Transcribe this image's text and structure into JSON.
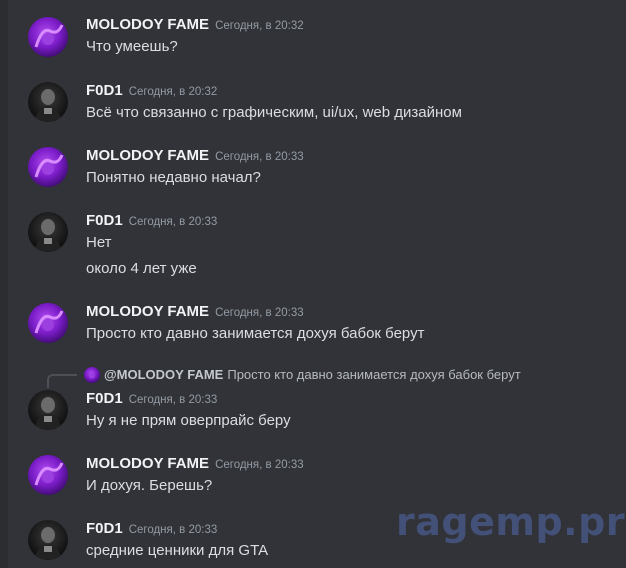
{
  "messages": [
    {
      "author": "MOLODOY FAME",
      "time": "Сегодня, в 20:32",
      "lines": [
        "Что умеешь?"
      ]
    },
    {
      "author": "F0D1",
      "time": "Сегодня, в 20:32",
      "lines": [
        "Всё что связанно с графическим, ui/ux, web дизайном"
      ]
    },
    {
      "author": "MOLODOY FAME",
      "time": "Сегодня, в 20:33",
      "lines": [
        "Понятно недавно начал?"
      ]
    },
    {
      "author": "F0D1",
      "time": "Сегодня, в 20:33",
      "lines": [
        "Нет",
        "около 4 лет уже"
      ]
    },
    {
      "author": "MOLODOY FAME",
      "time": "Сегодня, в 20:33",
      "lines": [
        "Просто кто давно занимается дохуя бабок берут"
      ]
    },
    {
      "author": "F0D1",
      "time": "Сегодня, в 20:33",
      "lines": [
        "Ну я не прям оверпрайс беру"
      ],
      "reply": {
        "author": "@MOLODOY FAME",
        "text": "Просто кто давно занимается дохуя бабок берут"
      }
    },
    {
      "author": "MOLODOY FAME",
      "time": "Сегодня, в 20:33",
      "lines": [
        "И дохуя. Берешь?"
      ]
    },
    {
      "author": "F0D1",
      "time": "Сегодня, в 20:33",
      "lines": [
        "средние ценники для GTA"
      ]
    }
  ],
  "watermark": "ragemp.pro",
  "colors": {
    "background": "#313338",
    "username": "#f2f3f5",
    "text": "#dbdee1",
    "timestamp": "#949ba4",
    "avatar_purple": "#7a1cc8",
    "watermark": "#4a5a8c"
  }
}
